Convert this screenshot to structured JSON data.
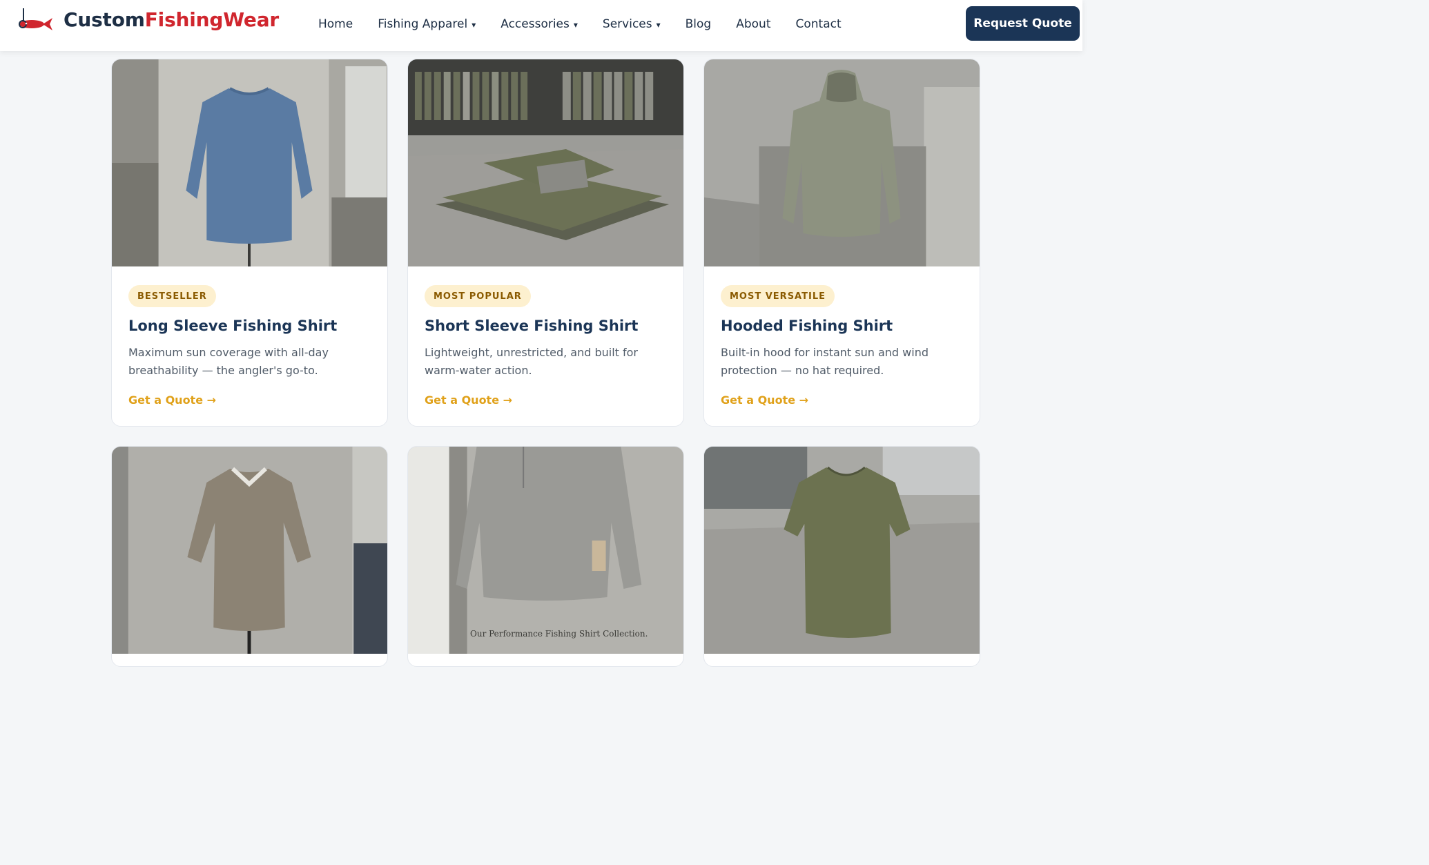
{
  "brand": {
    "part1": "Custom",
    "part2": "FishingWear"
  },
  "nav": {
    "items": [
      {
        "label": "Home",
        "dropdown": false
      },
      {
        "label": "Fishing Apparel",
        "dropdown": true
      },
      {
        "label": "Accessories",
        "dropdown": true
      },
      {
        "label": "Services",
        "dropdown": true
      },
      {
        "label": "Blog",
        "dropdown": false
      },
      {
        "label": "About",
        "dropdown": false
      },
      {
        "label": "Contact",
        "dropdown": false
      }
    ],
    "caret": "▾",
    "cta": "Request Quote"
  },
  "products": [
    {
      "badge": "BESTSELLER",
      "title": "Long Sleeve Fishing Shirt",
      "desc": "Maximum sun coverage with all-day breathability — the angler's go-to.",
      "link": "Get a Quote →",
      "image": "blue-long-sleeve-shirt"
    },
    {
      "badge": "MOST POPULAR",
      "title": "Short Sleeve Fishing Shirt",
      "desc": "Lightweight, unrestricted, and built for warm-water action.",
      "link": "Get a Quote →",
      "image": "folded-green-short-sleeve-shirt"
    },
    {
      "badge": "MOST VERSATILE",
      "title": "Hooded Fishing Shirt",
      "desc": "Built-in hood for instant sun and wind protection — no hat required.",
      "link": "Get a Quote →",
      "image": "grey-hooded-shirt"
    },
    {
      "image": "tan-button-up-shirt"
    },
    {
      "image": "grey-quarter-zip-shirt",
      "caption": "Our Performance Fishing Shirt Collection."
    },
    {
      "image": "olive-womens-tee"
    }
  ],
  "colors": {
    "navy": "#1b3556",
    "red": "#d0262e",
    "gold": "#e0a11a",
    "badge_bg": "#fdf0cf"
  }
}
